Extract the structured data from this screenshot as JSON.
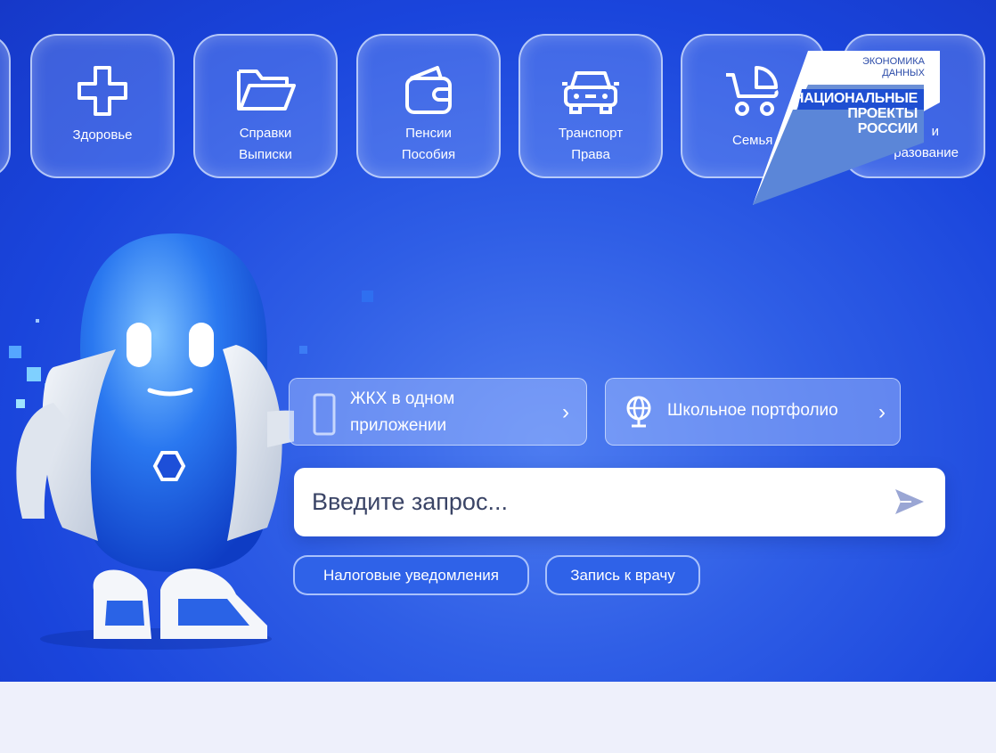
{
  "categories": [
    {
      "id": "health",
      "lines": [
        "Здоровье"
      ],
      "icon": "plus-cross-icon"
    },
    {
      "id": "certificates",
      "lines": [
        "Справки",
        "Выписки"
      ],
      "icon": "folder-icon"
    },
    {
      "id": "pensions",
      "lines": [
        "Пенсии",
        "Пособия"
      ],
      "icon": "wallet-icon"
    },
    {
      "id": "transport",
      "lines": [
        "Транспорт",
        "Права"
      ],
      "icon": "car-icon"
    },
    {
      "id": "family",
      "lines": [
        "Семья"
      ],
      "icon": "stroller-icon"
    },
    {
      "id": "education",
      "lines": [
        "и",
        "разование"
      ],
      "icon": "education-icon"
    }
  ],
  "logo": {
    "top_line_1": "ЭКОНОМИКА",
    "top_line_2": "ДАННЫХ",
    "main_line_1": "НАЦИОНАЛЬНЫЕ",
    "main_line_2": "ПРОЕКТЫ",
    "main_line_3": "РОССИИ"
  },
  "quick_links": [
    {
      "id": "zhkh",
      "lines": [
        "ЖКХ в одном",
        "приложении"
      ],
      "icon": "building-icon"
    },
    {
      "id": "school",
      "lines": [
        "Школьное портфолио"
      ],
      "icon": "globe-icon"
    }
  ],
  "search": {
    "placeholder": "Введите запрос...",
    "icon": "send-icon"
  },
  "suggestions": [
    {
      "id": "tax",
      "label": "Налоговые уведомления"
    },
    {
      "id": "doctor",
      "label": "Запись к врачу"
    }
  ],
  "colors": {
    "hero_blue": "#1a45dc",
    "chip_blue": "#2f62e8",
    "page_bg": "#eef0fb",
    "search_icon": "#9aa6d4"
  }
}
